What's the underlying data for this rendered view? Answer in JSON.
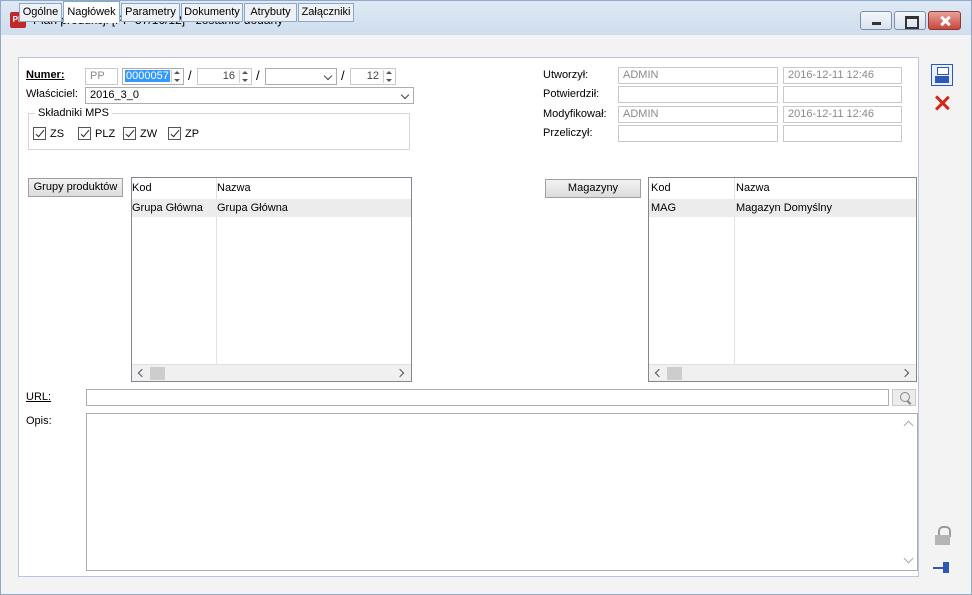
{
  "window": {
    "title": "Plan produkcji [PP-57/16/12] - zostanie dodany",
    "icon": "pp-app-icon"
  },
  "tabs": [
    "Ogólne",
    "Nagłówek",
    "Parametry",
    "Dokumenty",
    "Atrybuty",
    "Załączniki"
  ],
  "active_tab": "Nagłówek",
  "header": {
    "numer_label": "Numer:",
    "numer_prefix": "PP",
    "numer_value": "0000057",
    "numer_sep1": "/",
    "numer_month": "16",
    "numer_sep2": "/",
    "numer_series": "",
    "numer_sep3": "/",
    "numer_year": "12",
    "owner_label": "Właściciel:",
    "owner_value": "2016_3_0"
  },
  "mps": {
    "title": "Składniki MPS",
    "items": [
      {
        "label": "ZS",
        "checked": true
      },
      {
        "label": "PLZ",
        "checked": true
      },
      {
        "label": "ZW",
        "checked": true
      },
      {
        "label": "ZP",
        "checked": true
      }
    ]
  },
  "audit": {
    "created_label": "Utworzył:",
    "created_user": "ADMIN",
    "created_date": "2016-12-11 12:46",
    "approved_label": "Potwierdził:",
    "approved_user": "",
    "approved_date": "",
    "modified_label": "Modyfikował:",
    "modified_user": "ADMIN",
    "modified_date": "2016-12-11 12:46",
    "recalc_label": "Przeliczył:",
    "recalc_user": "",
    "recalc_date": ""
  },
  "groups": {
    "button_label": "Grupy produktów",
    "columns": [
      "Kod",
      "Nazwa"
    ],
    "rows": [
      [
        "Grupa Główna",
        "Grupa Główna"
      ]
    ]
  },
  "warehouses": {
    "button_label": "Magazyny",
    "columns": [
      "Kod",
      "Nazwa"
    ],
    "rows": [
      [
        "MAG",
        "Magazyn Domyślny"
      ]
    ]
  },
  "url": {
    "label": "URL:",
    "value": ""
  },
  "opis": {
    "label": "Opis:",
    "value": ""
  },
  "toolbar_icons": [
    "save-icon",
    "cancel-icon",
    "lock-icon",
    "pin-icon"
  ]
}
